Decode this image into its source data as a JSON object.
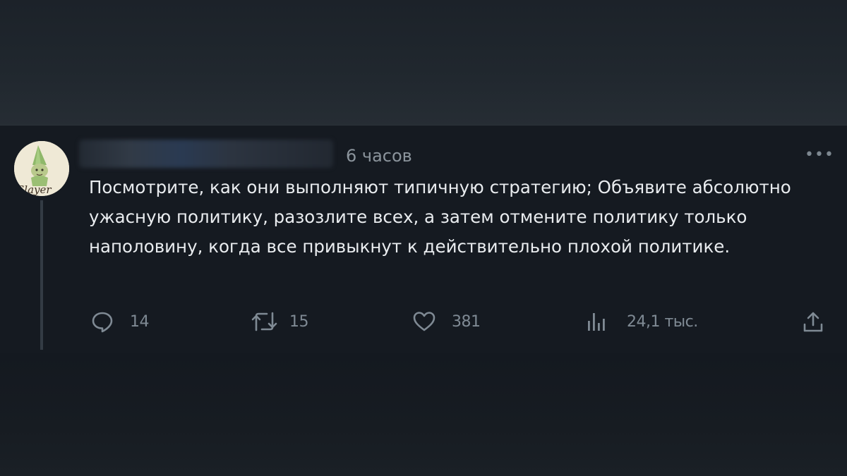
{
  "tweet": {
    "time": "6 часов",
    "text": "Посмотрите, как они выполняют типичную стратегию; Объявите абсолютно ужасную политику, разозлите всех, а затем отмените политику только наполовину, когда все привыкнут к действительно плохой политике.",
    "more_icon": "more-horizontal-icon",
    "avatar_text": "Slayer"
  },
  "actions": {
    "replies": "14",
    "retweets": "15",
    "likes": "381",
    "views": "24,1 тыс."
  },
  "colors": {
    "background": "#141920",
    "text": "#e9ecef",
    "muted": "#7f8a94"
  }
}
